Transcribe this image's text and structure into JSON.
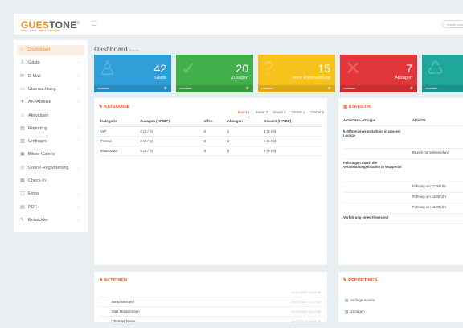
{
  "app": {
    "logo_a": "GUES",
    "logo_b": "TONE",
    "logo_reg": "®",
    "tagline_a": "crew · guest · event | ",
    "tagline_b": "managed",
    "search_placeholder": "Suche suchen..."
  },
  "sidebar": {
    "items": [
      {
        "label": "Dashboard",
        "icon": "home-icon",
        "active": true,
        "chev": ""
      },
      {
        "label": "Gäste",
        "icon": "users-icon",
        "chev": "‹"
      },
      {
        "label": "E-Mail",
        "icon": "mail-icon",
        "chev": "‹"
      },
      {
        "label": "Übernachtung",
        "icon": "bed-icon",
        "chev": "‹"
      },
      {
        "label": "An-/Abreise",
        "icon": "plane-icon",
        "chev": "‹"
      },
      {
        "label": "Aktivitäten",
        "icon": "activity-icon",
        "chev": ""
      },
      {
        "label": "Reporting",
        "icon": "report-icon",
        "chev": "‹"
      },
      {
        "label": "Umfragen",
        "icon": "chart-icon",
        "chev": "‹"
      },
      {
        "label": "Bilder-Galerie",
        "icon": "image-icon",
        "chev": ""
      },
      {
        "label": "Online-Registrierung",
        "icon": "globe-icon",
        "chev": "‹"
      },
      {
        "label": "Check-In",
        "icon": "checkin-icon",
        "chev": ""
      },
      {
        "label": "Extra",
        "icon": "folder-icon",
        "chev": "‹"
      },
      {
        "label": "PDF",
        "icon": "pdf-icon",
        "chev": "‹"
      },
      {
        "label": "Entwickler",
        "icon": "wrench-icon",
        "chev": "‹"
      }
    ]
  },
  "header": {
    "title": "Dashboard",
    "subtitle": "Events"
  },
  "stats": [
    {
      "value": "42",
      "caption": "Gäste",
      "footer": "ANZEIGEN",
      "color": "#2f9fd9"
    },
    {
      "value": "20",
      "caption": "Zusagen",
      "footer": "ANZEIGEN",
      "color": "#41b04a"
    },
    {
      "value": "15",
      "caption": "ohne Rückmeldung",
      "footer": "ANZEIGEN",
      "color": "#f6c21b"
    },
    {
      "value": "7",
      "caption": "Absagen",
      "footer": "ANZEIGEN",
      "color": "#e2373a"
    },
    {
      "value": "",
      "caption": "",
      "footer": "ANZEIGEN",
      "color": "#1fa89a"
    }
  ],
  "kategorie": {
    "title": "KATEGORIE",
    "tabs": [
      "Event 1",
      "Event 2",
      "Event 3",
      "Global 1",
      "Global 2"
    ],
    "active_tab": 0,
    "columns": [
      "Kategorie",
      "Zusagen (HP/BP)",
      "offen",
      "Absagen",
      "Gesamt (HP/BP)"
    ],
    "rows": [
      [
        "VIP",
        "2 (2 / 0)",
        "0",
        "1",
        "3 (3 / 0)"
      ],
      [
        "Presse",
        "2 (2 / 0)",
        "2",
        "1",
        "5 (5 / 0)"
      ],
      [
        "Mitarbeiter",
        "4 (4 / 0)",
        "3",
        "2",
        "9 (9 / 0)"
      ]
    ]
  },
  "statistik": {
    "title": "STATISTIK",
    "columns": [
      "Aktivitäten - Gruppe",
      "Aktivität"
    ],
    "rows": [
      {
        "group": "Eröffnungsveranstaltung in unserer Lounge",
        "activity": ""
      },
      {
        "group": "",
        "activity": "Brunch mit Sektempfang"
      },
      {
        "group": "Führungen durch die Veranstaltungslocation in Wuppertal",
        "activity": ""
      },
      {
        "group": "",
        "activity": "Führung um 11:00 Uhr"
      },
      {
        "group": "",
        "activity": "Führung um 13:00 Uhr"
      },
      {
        "group": "",
        "activity": "Führung um 15:00 Uhr"
      },
      {
        "group": "Vorführung eines Filmes mit",
        "activity": ""
      }
    ]
  },
  "aktionen": {
    "title": "AKTIONEN",
    "rows": [
      {
        "name": "",
        "date": "03.01.2020 11:09:45"
      },
      {
        "name": "Berta Beispiel",
        "date": "16.01.2020 11:07:12"
      },
      {
        "name": "Max Mustermann",
        "date": "09.06.2019 11:17:54"
      },
      {
        "name": "Thomas Tester",
        "date": "24.03.2019 10:06:29"
      },
      {
        "name": "Max Mustermann",
        "date": "09.03.2019 11:44:16"
      }
    ]
  },
  "reportings": {
    "title": "REPORTINGS",
    "items": [
      "Vorlage muster",
      "Zusagen"
    ]
  }
}
